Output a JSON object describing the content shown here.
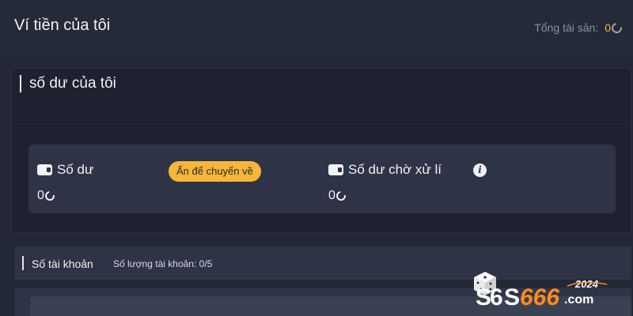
{
  "header": {
    "title": "Ví tiền của tôi",
    "total_label": "Tổng tài sản:",
    "total_value": "0"
  },
  "balance_section": {
    "title": "số dư của tôi",
    "balance_label": "Số dư",
    "balance_value": "0",
    "transfer_button": "Ấn để chuyển về",
    "pending_label": "Số dư chờ xử lí",
    "pending_value": "0"
  },
  "accounts_section": {
    "title": "Số tài khoản",
    "count_label": "Số lượng tài khoản:",
    "count_value": "0/5"
  },
  "brand": {
    "logo_text": "S6S666.com",
    "logo_year": "2024"
  },
  "colors": {
    "accent": "#f5b63a",
    "background": "#232836",
    "card": "#2e3446"
  },
  "icons": [
    "refresh-icon",
    "wallet-icon",
    "info-icon"
  ]
}
